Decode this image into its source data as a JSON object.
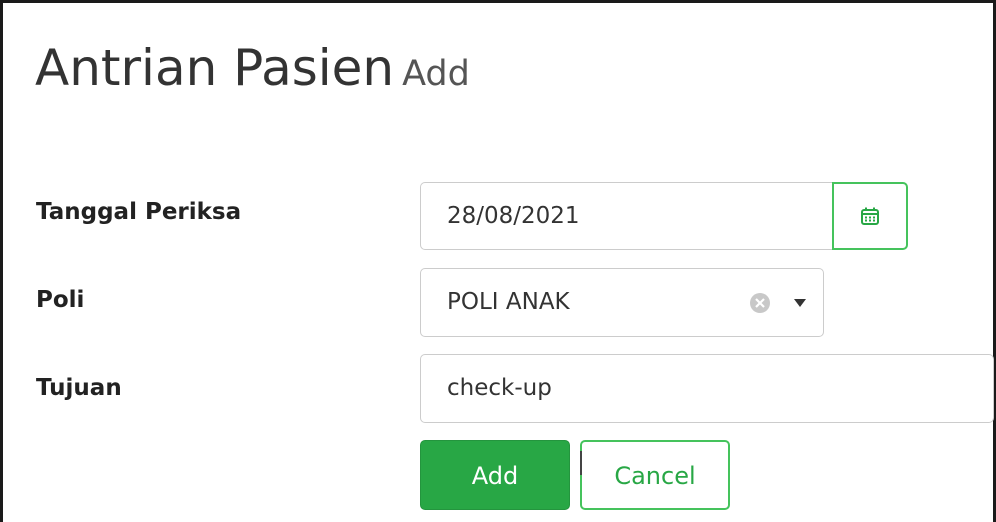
{
  "header": {
    "title": "Antrian Pasien",
    "subtitle": "Add"
  },
  "form": {
    "tanggal": {
      "label": "Tanggal Periksa",
      "value": "28/08/2021",
      "icon": "calendar-icon"
    },
    "poli": {
      "label": "Poli",
      "value": "POLI ANAK",
      "clear_icon": "clear-circle-icon",
      "caret_icon": "chevron-down-icon"
    },
    "tujuan": {
      "label": "Tujuan",
      "value": "check-up"
    }
  },
  "actions": {
    "add_label": "Add",
    "cancel_label": "Cancel"
  },
  "colors": {
    "accent": "#28a745",
    "accent_border": "#45c35c",
    "input_border": "#cccccc"
  }
}
